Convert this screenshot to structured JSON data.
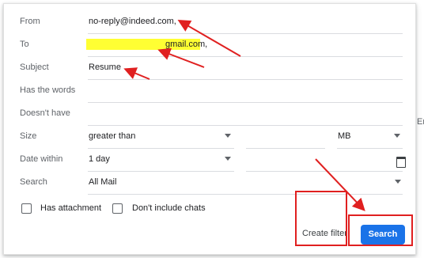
{
  "fields": {
    "from": {
      "label": "From",
      "value": "no-reply@indeed.com,"
    },
    "to": {
      "label": "To",
      "value_visible_suffix": "gmail.com,"
    },
    "subject": {
      "label": "Subject",
      "value": "Resume"
    },
    "has_words": {
      "label": "Has the words",
      "value": ""
    },
    "doesnt_have": {
      "label": "Doesn't have",
      "value": ""
    }
  },
  "size": {
    "label": "Size",
    "comparator": "greater than",
    "amount": "",
    "unit": "MB"
  },
  "date_within": {
    "label": "Date within",
    "value": "1 day",
    "date": ""
  },
  "search_in": {
    "label": "Search",
    "value": "All Mail"
  },
  "checkboxes": {
    "has_attachment": "Has attachment",
    "dont_include_chats": "Don't include chats"
  },
  "actions": {
    "create_filter": "Create filter",
    "search": "Search"
  },
  "side_text": "Er",
  "colors": {
    "accent": "#1a73e8",
    "annotation": "#e02020",
    "highlight": "#ffff33"
  },
  "icons": [
    "chevron-down-icon",
    "calendar-icon",
    "checkbox-icon"
  ]
}
